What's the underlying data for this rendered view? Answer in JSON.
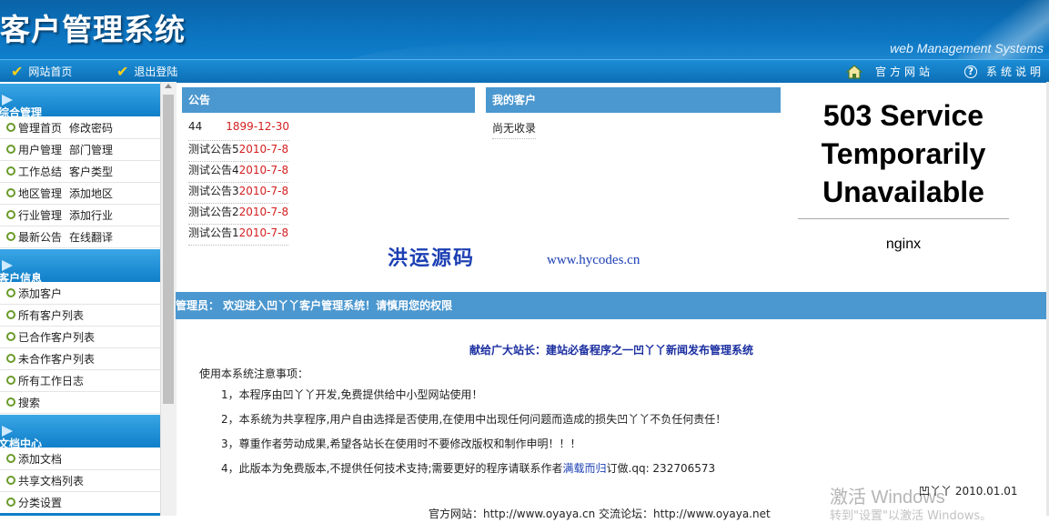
{
  "header": {
    "title": "客户管理系统",
    "subtitle": "web Management Systems"
  },
  "nav": {
    "home": "网站首页",
    "logout": "退出登陆",
    "official_site": "官方网站",
    "help": "系统说明"
  },
  "sidebar": {
    "sections": [
      {
        "title": "综合管理",
        "rows": [
          [
            "管理首页",
            "修改密码"
          ],
          [
            "用户管理",
            "部门管理"
          ],
          [
            "工作总结",
            "客户类型"
          ],
          [
            "地区管理",
            "添加地区"
          ],
          [
            "行业管理",
            "添加行业"
          ],
          [
            "最新公告",
            "在线翻译"
          ]
        ]
      },
      {
        "title": "客户信息",
        "rows": [
          [
            "添加客户"
          ],
          [
            "所有客户列表"
          ],
          [
            "已合作客户列表"
          ],
          [
            "未合作客户列表"
          ],
          [
            "所有工作日志"
          ],
          [
            "搜索"
          ]
        ]
      },
      {
        "title": "文档中心",
        "rows": [
          [
            "添加文档"
          ],
          [
            "共享文档列表"
          ],
          [
            "分类设置"
          ]
        ]
      }
    ]
  },
  "notice": {
    "title": "公告",
    "items": [
      {
        "name": "44",
        "date": "1899-12-30"
      },
      {
        "name": "测试公告5",
        "date": "2010-7-8"
      },
      {
        "name": "测试公告4",
        "date": "2010-7-8"
      },
      {
        "name": "测试公告3",
        "date": "2010-7-8"
      },
      {
        "name": "测试公告2",
        "date": "2010-7-8"
      },
      {
        "name": "测试公告1",
        "date": "2010-7-8"
      }
    ]
  },
  "my_customers": {
    "title": "我的客户",
    "empty": "尚无收录"
  },
  "watermark": {
    "cn": "洪运源码",
    "url": "www.hycodes.cn"
  },
  "error_page": {
    "heading": "503 Service Temporarily Unavailable",
    "server": "nginx"
  },
  "admin_bar": "管理员： 欢迎进入凹丫丫客户管理系统！请慎用您的权限",
  "dedication": "献给广大站长：建站必备程序之一凹丫丫新闻发布管理系统",
  "notes": {
    "intro": "使用本系统注意事项：",
    "items": [
      "1，本程序由凹丫丫开发,免费提供给中小型网站使用！",
      "2，本系统为共享程序,用户自由选择是否使用,在使用中出现任何问题而造成的损失凹丫丫不负任何责任！",
      "3，尊重作者劳动成果,希望各站长在使用时不要修改版权和制作申明！！！"
    ],
    "item4_pre": "4，此版本为免费版本,不提供任何技术支持;需要更好的程序请联系作者",
    "item4_link": "满载而归",
    "item4_post": "订做.qq: 232706573"
  },
  "signature": "凹丫丫  2010.01.01",
  "footer": "官方网站：http://www.oyaya.cn   交流论坛：http://www.oyaya.net",
  "windows_activation": {
    "line1": "激活 Windows",
    "line2": "转到\"设置\"以激活 Windows。"
  },
  "colors": {
    "banner": "#0b70bb",
    "panel_header": "#4b97cf",
    "date_red": "#d41f1f",
    "link_blue": "#1c3fb3"
  }
}
